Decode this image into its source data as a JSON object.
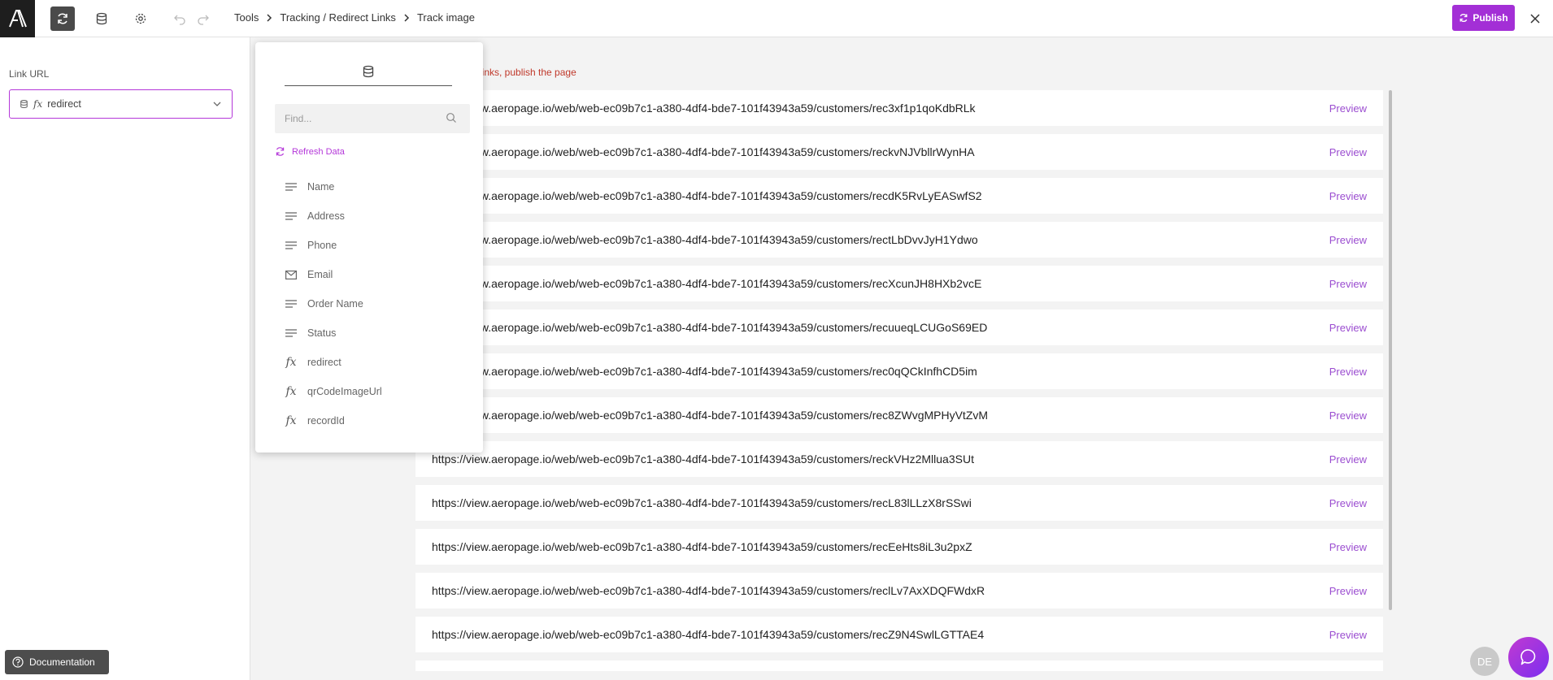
{
  "breadcrumb": [
    "Tools",
    "Tracking / Redirect Links",
    "Track image"
  ],
  "publish_label": "Publish",
  "left_panel": {
    "field_label": "Link URL",
    "select_value": "redirect",
    "documentation_label": "Documentation"
  },
  "notice": "e links, publish the page",
  "picker": {
    "find_placeholder": "Find...",
    "refresh_label": "Refresh Data",
    "fields": [
      {
        "label": "Name",
        "icon": "text-lines-icon"
      },
      {
        "label": "Address",
        "icon": "text-lines-icon"
      },
      {
        "label": "Phone",
        "icon": "text-lines-icon"
      },
      {
        "label": "Email",
        "icon": "envelope-icon"
      },
      {
        "label": "Order Name",
        "icon": "text-lines-icon"
      },
      {
        "label": "Status",
        "icon": "text-lines-icon"
      },
      {
        "label": "redirect",
        "icon": "fx-icon"
      },
      {
        "label": "qrCodeImageUrl",
        "icon": "fx-icon"
      },
      {
        "label": "recordId",
        "icon": "fx-icon"
      }
    ]
  },
  "rows": [
    {
      "url": "https://view.aeropage.io/web/web-ec09b7c1-a380-4df4-bde7-101f43943a59/customers/rec3xf1p1qoKdbRLk",
      "preview": "Preview"
    },
    {
      "url": "https://view.aeropage.io/web/web-ec09b7c1-a380-4df4-bde7-101f43943a59/customers/reckvNJVbllrWynHA",
      "preview": "Preview"
    },
    {
      "url": "https://view.aeropage.io/web/web-ec09b7c1-a380-4df4-bde7-101f43943a59/customers/recdK5RvLyEASwfS2",
      "preview": "Preview"
    },
    {
      "url": "https://view.aeropage.io/web/web-ec09b7c1-a380-4df4-bde7-101f43943a59/customers/rectLbDvvJyH1Ydwo",
      "preview": "Preview"
    },
    {
      "url": "https://view.aeropage.io/web/web-ec09b7c1-a380-4df4-bde7-101f43943a59/customers/recXcunJH8HXb2vcE",
      "preview": "Preview"
    },
    {
      "url": "https://view.aeropage.io/web/web-ec09b7c1-a380-4df4-bde7-101f43943a59/customers/recuueqLCUGoS69ED",
      "preview": "Preview"
    },
    {
      "url": "https://view.aeropage.io/web/web-ec09b7c1-a380-4df4-bde7-101f43943a59/customers/rec0qQCkInfhCD5im",
      "preview": "Preview"
    },
    {
      "url": "https://view.aeropage.io/web/web-ec09b7c1-a380-4df4-bde7-101f43943a59/customers/rec8ZWvgMPHyVtZvM",
      "preview": "Preview"
    },
    {
      "url": "https://view.aeropage.io/web/web-ec09b7c1-a380-4df4-bde7-101f43943a59/customers/reckVHz2Mllua3SUt",
      "preview": "Preview"
    },
    {
      "url": "https://view.aeropage.io/web/web-ec09b7c1-a380-4df4-bde7-101f43943a59/customers/recL83lLLzX8rSSwi",
      "preview": "Preview"
    },
    {
      "url": "https://view.aeropage.io/web/web-ec09b7c1-a380-4df4-bde7-101f43943a59/customers/recEeHts8iL3u2pxZ",
      "preview": "Preview"
    },
    {
      "url": "https://view.aeropage.io/web/web-ec09b7c1-a380-4df4-bde7-101f43943a59/customers/reclLv7AxXDQFWdxR",
      "preview": "Preview"
    },
    {
      "url": "https://view.aeropage.io/web/web-ec09b7c1-a380-4df4-bde7-101f43943a59/customers/recZ9N4SwlLGTTAE4",
      "preview": "Preview"
    }
  ],
  "avatar_initials": "DE",
  "colors": {
    "accent": "#a32fd6",
    "preview_link": "#9b4dd0",
    "notice": "#c0392b"
  }
}
